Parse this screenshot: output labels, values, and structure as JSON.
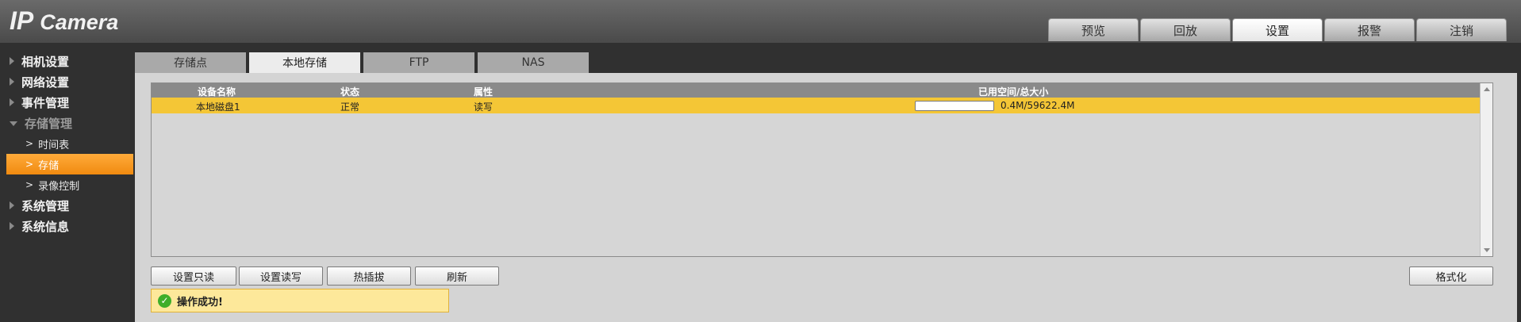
{
  "app": {
    "logo_ip": "IP",
    "logo_camera": "Camera"
  },
  "topnav": [
    {
      "label": "预览"
    },
    {
      "label": "回放"
    },
    {
      "label": "设置",
      "active": true
    },
    {
      "label": "报警"
    },
    {
      "label": "注销"
    }
  ],
  "sidebar": {
    "items": [
      {
        "label": "相机设置"
      },
      {
        "label": "网络设置"
      },
      {
        "label": "事件管理"
      },
      {
        "label": "存储管理"
      },
      {
        "label": "时间表"
      },
      {
        "label": "存储"
      },
      {
        "label": "录像控制"
      },
      {
        "label": "系统管理"
      },
      {
        "label": "系统信息"
      }
    ],
    "active": "存储"
  },
  "subtabs": [
    {
      "label": "存储点"
    },
    {
      "label": "本地存储"
    },
    {
      "label": "FTP"
    },
    {
      "label": "NAS"
    }
  ],
  "table": {
    "headers": [
      "设备名称",
      "状态",
      "属性",
      "已用空间/总大小"
    ],
    "rows": [
      {
        "name": "本地磁盘1",
        "status": "正常",
        "attribute": "读写",
        "usage": "0.4M/59622.4M",
        "used_fraction": 6.7e-06
      }
    ]
  },
  "buttons": {
    "set_readonly": "设置只读",
    "set_readwrite": "设置读写",
    "hotplug": "热插拔",
    "refresh": "刷新",
    "format": "格式化"
  },
  "status": {
    "message": "操作成功!"
  },
  "colors": {
    "accent": "#f08a10",
    "selected_row": "#f4c636",
    "success": "#3fae2a"
  }
}
